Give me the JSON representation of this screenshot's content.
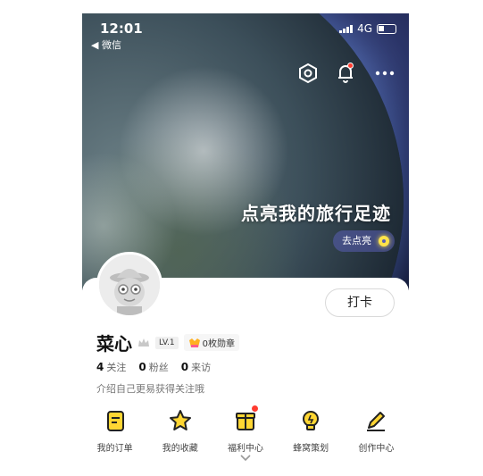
{
  "status_bar": {
    "time": "12:01",
    "back_app": "微信",
    "network": "4G"
  },
  "hero": {
    "slogan": "点亮我的旅行足迹",
    "light_button": "去点亮"
  },
  "profile": {
    "name": "菜心",
    "level": "LV.1",
    "badges": "0枚勋章",
    "checkin_label": "打卡",
    "bio": "介绍自己更易获得关注哦",
    "stats": [
      {
        "count": "4",
        "label": "关注"
      },
      {
        "count": "0",
        "label": "粉丝"
      },
      {
        "count": "0",
        "label": "来访"
      }
    ]
  },
  "menu": [
    {
      "label": "我的订单",
      "icon": "order-icon"
    },
    {
      "label": "我的收藏",
      "icon": "star-icon"
    },
    {
      "label": "福利中心",
      "icon": "gift-icon"
    },
    {
      "label": "蜂窝策划",
      "icon": "bulb-icon"
    },
    {
      "label": "创作中心",
      "icon": "pen-icon"
    }
  ],
  "colors": {
    "accent_yellow": "#FFD633",
    "notification_red": "#FF3B30"
  }
}
